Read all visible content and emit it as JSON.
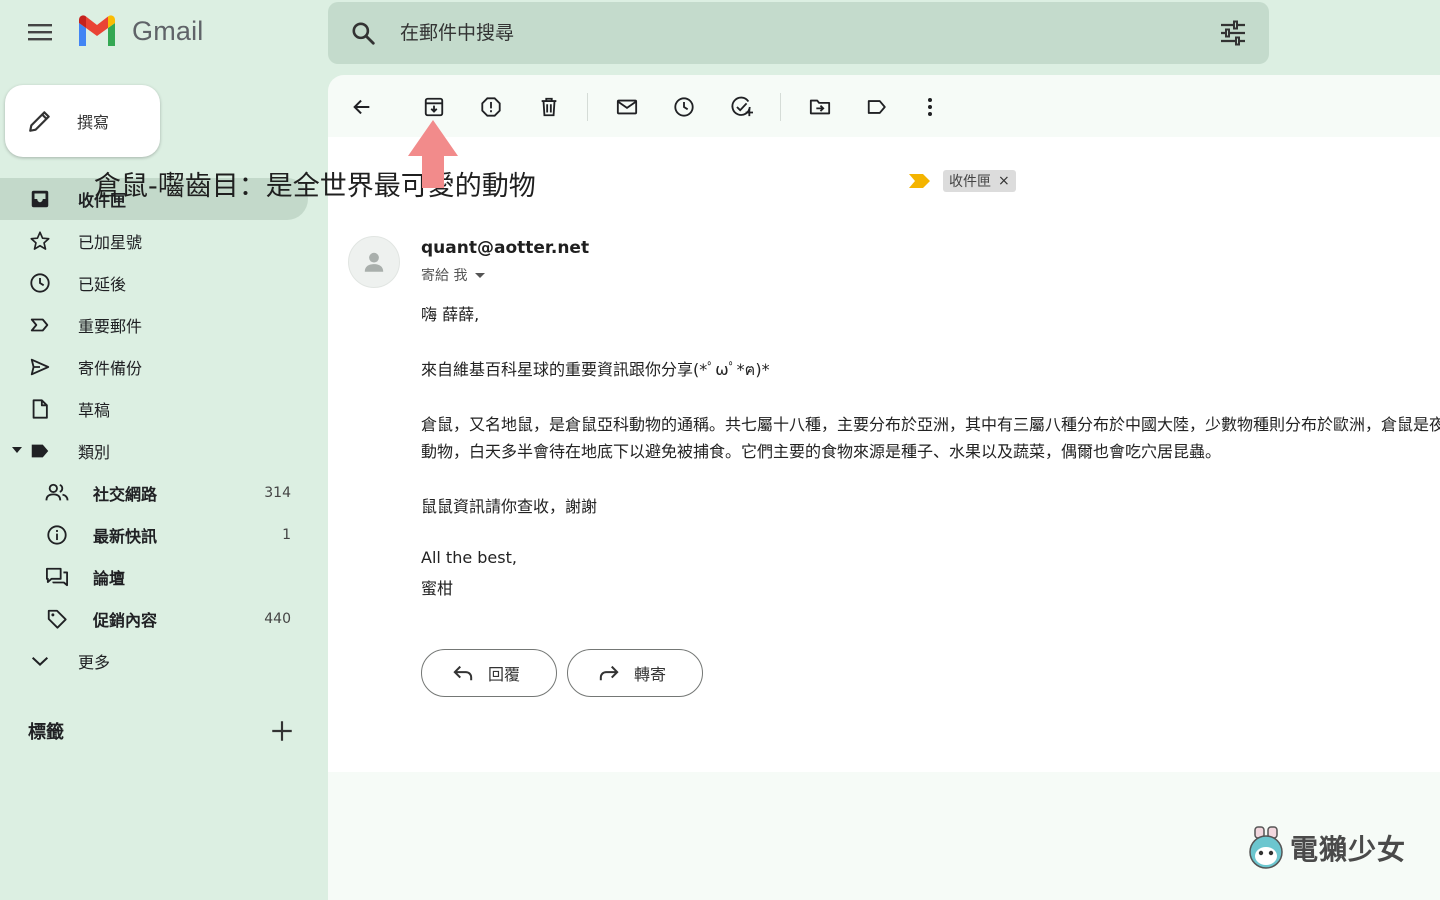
{
  "app": {
    "name": "Gmail"
  },
  "search": {
    "placeholder": "在郵件中搜尋"
  },
  "compose": {
    "label": "撰寫"
  },
  "sidebar": {
    "items": [
      {
        "label": "收件匣",
        "icon": "inbox-icon",
        "active": true
      },
      {
        "label": "已加星號",
        "icon": "star-icon"
      },
      {
        "label": "已延後",
        "icon": "clock-icon"
      },
      {
        "label": "重要郵件",
        "icon": "label-important-icon"
      },
      {
        "label": "寄件備份",
        "icon": "send-icon"
      },
      {
        "label": "草稿",
        "icon": "file-icon"
      },
      {
        "label": "類別",
        "icon": "label-icon"
      }
    ],
    "categories": [
      {
        "label": "社交網路",
        "count": "314",
        "icon": "people-icon"
      },
      {
        "label": "最新快訊",
        "count": "1",
        "icon": "info-icon"
      },
      {
        "label": "論壇",
        "count": "",
        "icon": "forum-icon"
      },
      {
        "label": "促銷內容",
        "count": "440",
        "icon": "tag-icon"
      }
    ],
    "more": "更多",
    "labels_title": "標籤"
  },
  "toolbar": {
    "icons": [
      "back-arrow-icon",
      "archive-icon",
      "report-spam-icon",
      "delete-icon",
      "mark-unread-icon",
      "snooze-icon",
      "add-task-icon",
      "move-to-icon",
      "label-icon",
      "more-vert-icon"
    ]
  },
  "email": {
    "subject": "倉鼠-囓齒目：是全世界最可愛的動物",
    "chip": "收件匣",
    "chip_close": "×",
    "sender": "quant@aotter.net",
    "to": "寄給 我",
    "greeting": "嗨 薛薛,",
    "line1": "來自維基百科星球的重要資訊跟你分享(*ﾟωﾟ*ฅ)*",
    "line2": "倉鼠，又名地鼠，是倉鼠亞科動物的通稱。共七屬十八種，主要分布於亞洲，其中有三屬八種分布於中國大陸，少數物種則分布於歐洲，倉鼠是夜行性",
    "line3": "動物，白天多半會待在地底下以避免被捕食。它們主要的食物來源是種子、水果以及蔬菜，偶爾也會吃穴居昆蟲。",
    "line4": "鼠鼠資訊請你查收，謝謝",
    "signoff": "All the best,",
    "signature": "蜜柑"
  },
  "actions": {
    "reply": "回覆",
    "forward": "轉寄"
  },
  "watermark": "電獺少女",
  "colors": {
    "accent_arrow": "#f28b8b",
    "background": "#dcefe2",
    "search": "#c4dbcc",
    "active_item": "#c3d9ca"
  }
}
